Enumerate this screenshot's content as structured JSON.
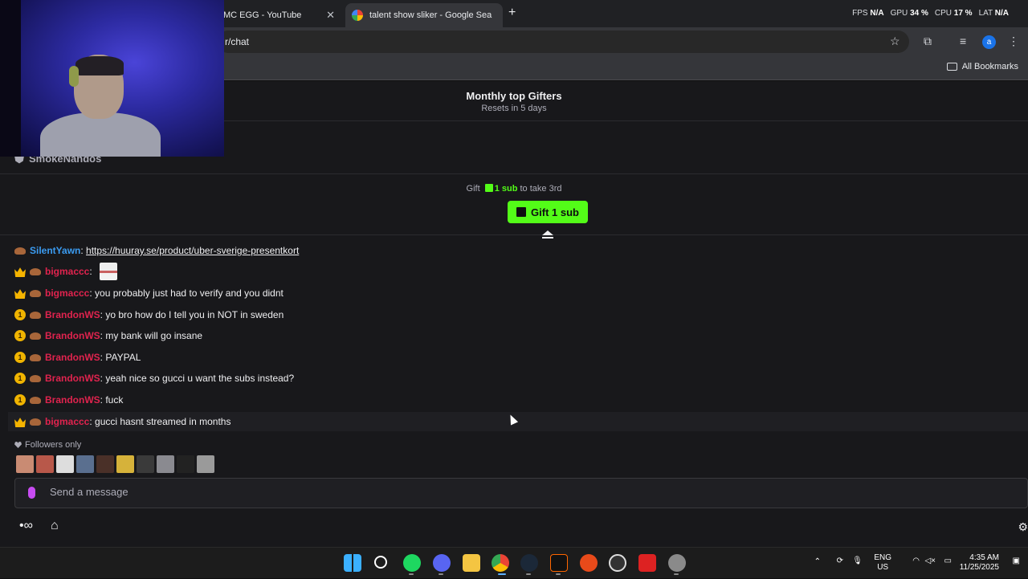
{
  "browser": {
    "tabs": [
      {
        "title": "MC EGG - YouTube"
      },
      {
        "title": "talent show sliker - Google Sea"
      }
    ],
    "new_tab": "+",
    "url": "r/chat",
    "all_bookmarks": "All Bookmarks",
    "profile_initial": "a"
  },
  "overlay": {
    "fps_label": "FPS",
    "fps_value": "N/A",
    "gpu_label": "GPU",
    "gpu_value": "34 %",
    "cpu_label": "CPU",
    "cpu_value": "17 %",
    "lat_label": "LAT",
    "lat_value": "N/A"
  },
  "gifters": {
    "title": "Monthly top Gifters",
    "reset": "Resets in 5 days",
    "top_user": "SmokeNandos"
  },
  "gift": {
    "prefix": "Gift",
    "amount": "1 sub",
    "suffix": "to take 3rd",
    "button": "Gift 1 sub"
  },
  "messages": [
    {
      "user": "SilentYawn",
      "color": "#3b9cf2",
      "badges": [
        "hat"
      ],
      "text": "https://huuray.se/product/uber-sverige-presentkort",
      "link": true
    },
    {
      "user": "bigmaccc",
      "color": "#e0234e",
      "badges": [
        "crown",
        "hat"
      ],
      "text": "",
      "emote": true
    },
    {
      "user": "bigmaccc",
      "color": "#e0234e",
      "badges": [
        "crown",
        "hat"
      ],
      "text": "you probably just had to verify and you didnt"
    },
    {
      "user": "BrandonWS",
      "color": "#e0234e",
      "badges": [
        "one",
        "hat"
      ],
      "text": "yo bro how do I tell you in NOT in sweden"
    },
    {
      "user": "BrandonWS",
      "color": "#e0234e",
      "badges": [
        "one",
        "hat"
      ],
      "text": "my bank will go insane"
    },
    {
      "user": "BrandonWS",
      "color": "#e0234e",
      "badges": [
        "one",
        "hat"
      ],
      "text": "PAYPAL"
    },
    {
      "user": "BrandonWS",
      "color": "#e0234e",
      "badges": [
        "one",
        "hat"
      ],
      "text": "yeah nice so gucci u want the subs instead?"
    },
    {
      "user": "BrandonWS",
      "color": "#e0234e",
      "badges": [
        "one",
        "hat"
      ],
      "text": "fuck"
    },
    {
      "user": "bigmaccc",
      "color": "#e0234e",
      "badges": [
        "crown",
        "hat"
      ],
      "text": "gucci hasnt streamed in months"
    }
  ],
  "chat": {
    "followers_only": "Followers only",
    "placeholder": "Send a message"
  },
  "taskbar": {
    "language": "ENG",
    "region": "US",
    "time": "4:35 AM",
    "date": "11/25/2025"
  }
}
